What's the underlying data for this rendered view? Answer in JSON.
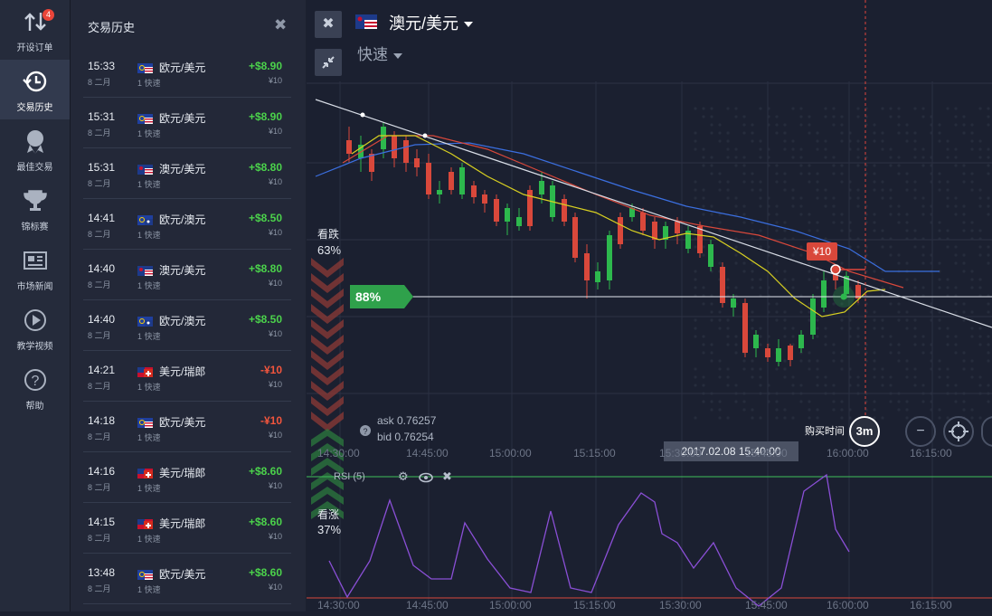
{
  "nav": {
    "items": [
      {
        "label": "开设订单",
        "icon": "open-order-icon",
        "badge": "4"
      },
      {
        "label": "交易历史",
        "icon": "history-icon"
      },
      {
        "label": "最佳交易",
        "icon": "medal-icon"
      },
      {
        "label": "锦标赛",
        "icon": "trophy-icon"
      },
      {
        "label": "市场新闻",
        "icon": "news-icon"
      },
      {
        "label": "教学视频",
        "icon": "play-icon"
      },
      {
        "label": "帮助",
        "icon": "help-icon"
      }
    ]
  },
  "history": {
    "title": "交易历史",
    "close": "✖",
    "trades": [
      {
        "time": "15:33",
        "date": "8 二月",
        "pair": "欧元/美元",
        "flag": "eu-us",
        "type": "1 快速",
        "profit": "+$8.90",
        "stake": "¥10",
        "win": true
      },
      {
        "time": "15:31",
        "date": "8 二月",
        "pair": "欧元/美元",
        "flag": "eu-us",
        "type": "1 快速",
        "profit": "+$8.90",
        "stake": "¥10",
        "win": true
      },
      {
        "time": "15:31",
        "date": "8 二月",
        "pair": "澳元/美元",
        "flag": "au-us",
        "type": "1 快速",
        "profit": "+$8.80",
        "stake": "¥10",
        "win": true
      },
      {
        "time": "14:41",
        "date": "8 二月",
        "pair": "欧元/澳元",
        "flag": "eu-au",
        "type": "1 快速",
        "profit": "+$8.50",
        "stake": "¥10",
        "win": true
      },
      {
        "time": "14:40",
        "date": "8 二月",
        "pair": "澳元/美元",
        "flag": "au-us",
        "type": "1 快速",
        "profit": "+$8.80",
        "stake": "¥10",
        "win": true
      },
      {
        "time": "14:40",
        "date": "8 二月",
        "pair": "欧元/澳元",
        "flag": "eu-au",
        "type": "1 快速",
        "profit": "+$8.50",
        "stake": "¥10",
        "win": true
      },
      {
        "time": "14:21",
        "date": "8 二月",
        "pair": "美元/瑞郎",
        "flag": "us-ch",
        "type": "1 快速",
        "profit": "-¥10",
        "stake": "¥10",
        "win": false
      },
      {
        "time": "14:18",
        "date": "8 二月",
        "pair": "欧元/美元",
        "flag": "eu-us",
        "type": "1 快速",
        "profit": "-¥10",
        "stake": "¥10",
        "win": false
      },
      {
        "time": "14:16",
        "date": "8 二月",
        "pair": "美元/瑞郎",
        "flag": "us-ch",
        "type": "1 快速",
        "profit": "+$8.60",
        "stake": "¥10",
        "win": true
      },
      {
        "time": "14:15",
        "date": "8 二月",
        "pair": "美元/瑞郎",
        "flag": "us-ch",
        "type": "1 快速",
        "profit": "+$8.60",
        "stake": "¥10",
        "win": true
      },
      {
        "time": "13:48",
        "date": "8 二月",
        "pair": "欧元/美元",
        "flag": "eu-us",
        "type": "1 快速",
        "profit": "+$8.60",
        "stake": "¥10",
        "win": true
      }
    ]
  },
  "chart": {
    "pair": "澳元/美元",
    "mode": "快速",
    "put_label": "看跌",
    "put_pct": "63%",
    "call_label": "看涨",
    "call_pct": "37%",
    "payout": "88%",
    "ask": "ask 0.76257",
    "bid": "bid 0.76254",
    "current_time": "2017.02.08 15:40:00",
    "buy_time_label": "购买时间",
    "expiry": "3m",
    "stake_tag": "¥10",
    "rsi_label": "RSI (5)",
    "time_ticks": [
      "14:30:00",
      "14:45:00",
      "15:00:00",
      "15:15:00",
      "15:30:00",
      "15:45:00",
      "16:00:00",
      "16:15:00"
    ],
    "zoom_out": "−",
    "colors": {
      "up": "#2db84d",
      "down": "#d9483b",
      "ma_red": "#d9483b",
      "ma_blue": "#3b6fe0",
      "ma_yellow": "#d8d021",
      "rsi": "#8a4fd6"
    }
  }
}
